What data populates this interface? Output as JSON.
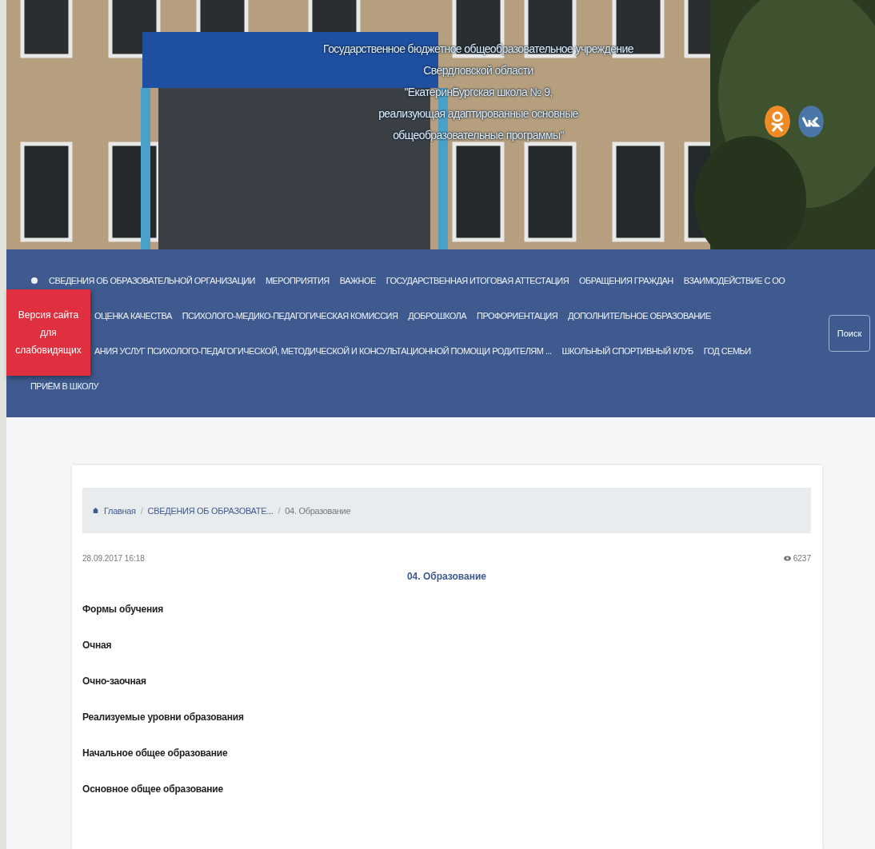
{
  "header": {
    "title_lines": [
      "Государственное бюджетное общеобразовательное учреждение",
      "Свердловской области",
      "\"ЕкатеринБургская школа № 9,",
      "реализующая адаптированные основные",
      "общеобразовательные программы\""
    ],
    "social": [
      {
        "kind": "ok"
      },
      {
        "kind": "vk"
      }
    ]
  },
  "accessibility_badge": {
    "lines": [
      "Версия сайта",
      "для",
      "слабовидящих"
    ]
  },
  "nav": {
    "rows": [
      {
        "items": [
          "СВЕДЕНИЯ ОБ ОБРАЗОВАТЕЛЬНОЙ ОРГАНИЗАЦИИ",
          "МЕРОПРИЯТИЯ",
          "ВАЖНОЕ",
          "ГОСУДАРСТВЕННАЯ ИТОГОВАЯ АТТЕСТАЦИЯ",
          "ОБРАЩЕНИЯ ГРАЖДАН",
          "ВЗАИМОДЕЙСТВИЕ С ОО"
        ]
      },
      {
        "items": [
          "ОЦЕНКА КАЧЕСТВА",
          "ПСИХОЛОГО-МЕДИКО-ПЕДАГОГИЧЕСКАЯ КОМИССИЯ",
          "ДОБРОШКОЛА",
          "ПРОФОРИЕНТАЦИЯ",
          "ДОПОЛНИТЕЛЬНОЕ ОБРАЗОВАНИЕ"
        ]
      },
      {
        "items": [
          "АНИЯ УСЛУГ ПСИХОЛОГО-ПЕДАГОГИЧЕСКОЙ, МЕТОДИЧЕСКОЙ И КОНСУЛЬТАЦИОННОЙ ПОМОЩИ РОДИТЕЛЯМ ...",
          "ШКОЛЬНЫЙ СПОРТИВНЫЙ КЛУБ",
          "ГОД СЕМЬИ"
        ]
      },
      {
        "items": [
          "ПРИЁМ В ШКОЛУ"
        ]
      }
    ],
    "search_button": "Поиск"
  },
  "breadcrumb": {
    "separator": "/",
    "items": [
      {
        "label": "Главная",
        "kind": "home"
      },
      {
        "label": "СВЕДЕНИЯ ОБ ОБРАЗОВАТЕ...",
        "kind": "link"
      },
      {
        "label": "04. Образование",
        "kind": "current"
      }
    ]
  },
  "article": {
    "date": "28.09.2017 16:18",
    "views": "6237",
    "title": "04. Образование",
    "paragraphs": [
      "Формы обучения",
      "Очная",
      "Очно-заочная",
      "Реализуемые уровни образования",
      "Начальное общее образование",
      "Основное общее образование"
    ]
  }
}
